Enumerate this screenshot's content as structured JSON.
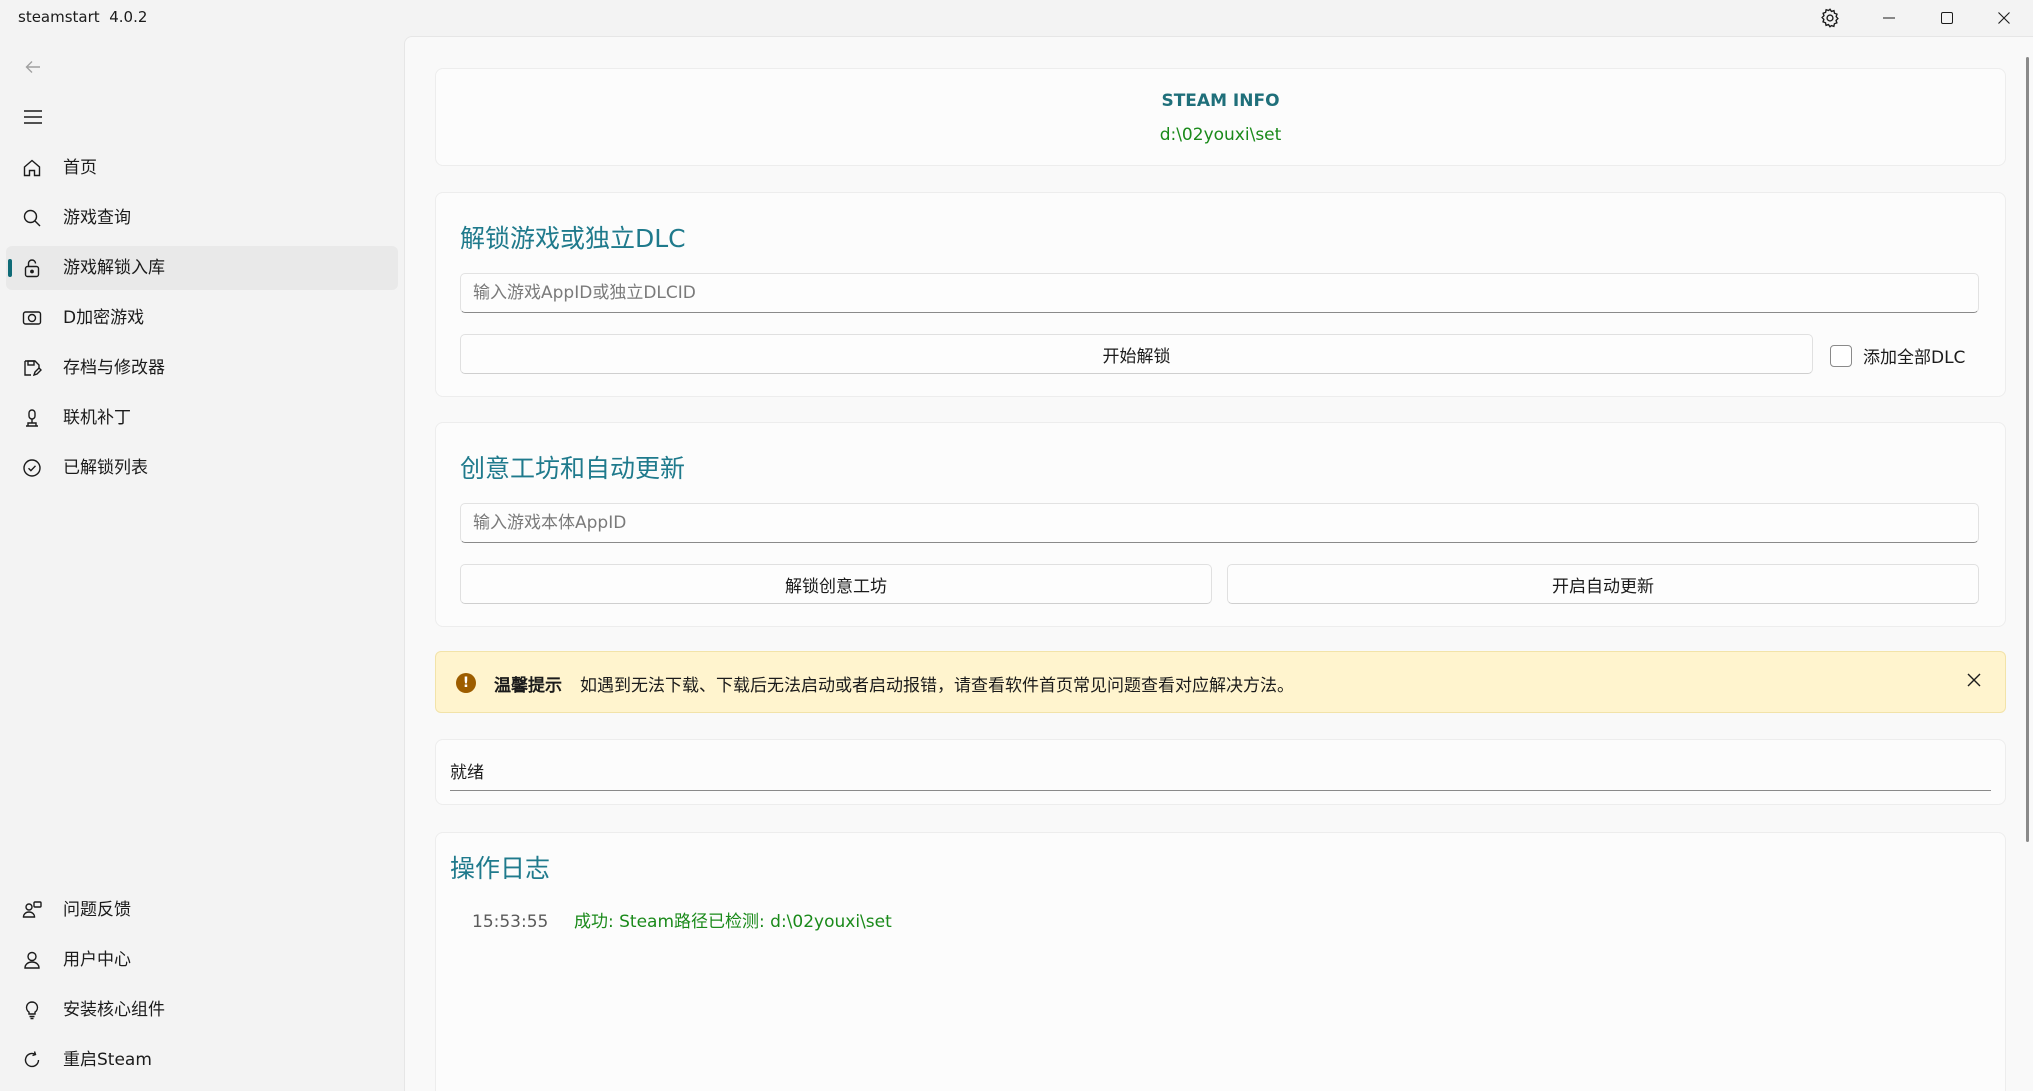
{
  "window": {
    "app_name": "steamstart",
    "version": "4.0.2"
  },
  "titlebar": {
    "settings_icon": "gear-icon",
    "minimize_icon": "minimize-icon",
    "maximize_icon": "maximize-icon",
    "close_icon": "close-icon"
  },
  "sidebar": {
    "back_icon": "arrow-left-icon",
    "menu_icon": "hamburger-icon",
    "items": [
      {
        "label": "首页",
        "icon": "home-icon"
      },
      {
        "label": "游戏查询",
        "icon": "search-icon"
      },
      {
        "label": "游戏解锁入库",
        "icon": "lock-open-icon",
        "active": true
      },
      {
        "label": "D加密游戏",
        "icon": "disc-icon"
      },
      {
        "label": "存档与修改器",
        "icon": "save-edit-icon"
      },
      {
        "label": "联机补丁",
        "icon": "joystick-icon"
      },
      {
        "label": "已解锁列表",
        "icon": "check-circle-icon"
      }
    ],
    "footer_items": [
      {
        "label": "问题反馈",
        "icon": "feedback-icon"
      },
      {
        "label": "用户中心",
        "icon": "user-icon"
      },
      {
        "label": "安装核心组件",
        "icon": "lightbulb-icon"
      },
      {
        "label": "重启Steam",
        "icon": "refresh-icon"
      }
    ]
  },
  "steam_info": {
    "title": "STEAM INFO",
    "path": "d:\\02youxi\\set"
  },
  "unlock_section": {
    "title": "解锁游戏或独立DLC",
    "input_placeholder": "输入游戏AppID或独立DLCID",
    "input_value": "",
    "start_button": "开始解锁",
    "checkbox_label": "添加全部DLC",
    "checkbox_checked": false
  },
  "workshop_section": {
    "title": "创意工坊和自动更新",
    "input_placeholder": "输入游戏本体AppID",
    "input_value": "",
    "workshop_button": "解锁创意工坊",
    "auto_update_button": "开启自动更新"
  },
  "notice": {
    "icon": "warning-icon",
    "title": "温馨提示",
    "message": "如遇到无法下载、下载后无法启动或者启动报错，请查看软件首页常见问题查看对应解决方法。",
    "color": "#fff4ce"
  },
  "status": {
    "text": "就绪"
  },
  "log": {
    "title": "操作日志",
    "entries": [
      {
        "time": "15:53:55",
        "message": "成功: Steam路径已检测: d:\\02youxi\\set"
      }
    ]
  },
  "colors": {
    "accent": "#1f7a8c",
    "success": "#1a8a1a",
    "active_indicator": "#0f6b77"
  }
}
